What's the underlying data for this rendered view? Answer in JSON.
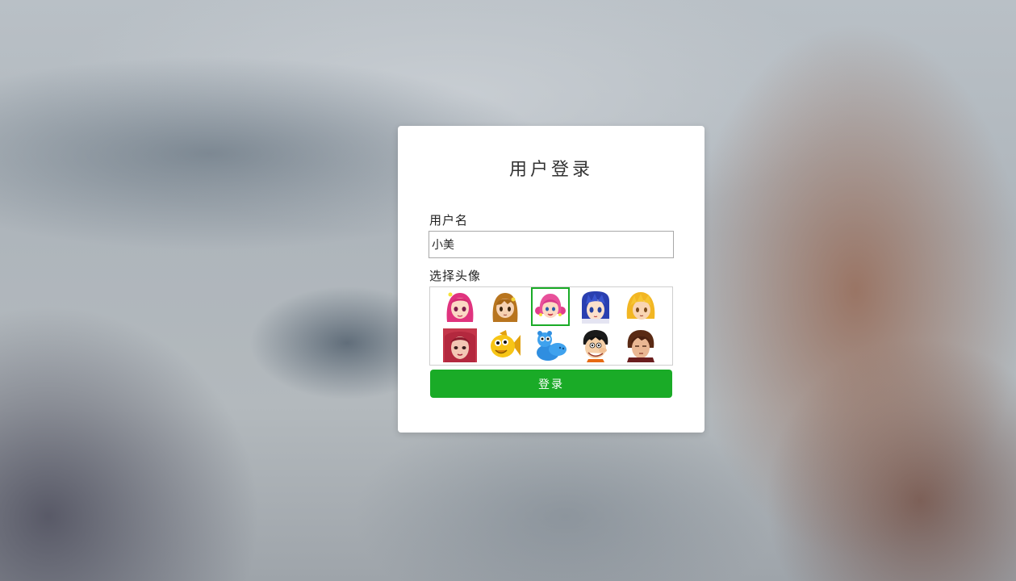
{
  "login": {
    "title": "用户登录",
    "username_label": "用户名",
    "username_value": "小美",
    "avatar_label": "选择头像",
    "submit_label": "登录"
  },
  "avatars": [
    {
      "name": "pink-hair-girl-avatar",
      "selected": false
    },
    {
      "name": "brown-hair-girl-avatar",
      "selected": false
    },
    {
      "name": "pigtail-girl-avatar",
      "selected": true
    },
    {
      "name": "blue-hair-boy-avatar",
      "selected": false
    },
    {
      "name": "blonde-boy-avatar",
      "selected": false
    },
    {
      "name": "red-hair-woman-avatar",
      "selected": false
    },
    {
      "name": "yellow-fish-avatar",
      "selected": false
    },
    {
      "name": "blue-hippo-avatar",
      "selected": false
    },
    {
      "name": "cartoon-man-avatar",
      "selected": false
    },
    {
      "name": "brown-hair-man-avatar",
      "selected": false
    }
  ],
  "colors": {
    "accent": "#1aab27",
    "card": "#ffffff"
  }
}
